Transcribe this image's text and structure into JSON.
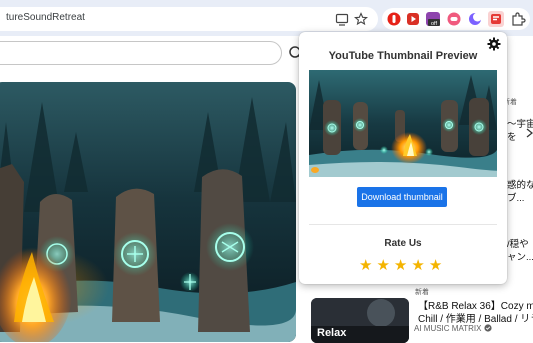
{
  "browser": {
    "url": "tureSoundRetreat"
  },
  "youtube": {
    "side_snippets": [
      "～宇宙",
      "を",
      "惑的な",
      "ブ...",
      "/穏や",
      "ャン..."
    ],
    "badge": "新着",
    "side_video": {
      "thumb_caption": "Relax",
      "title_line1": "【R&B Relax 36】Cozy music /",
      "title_line2": "Chill / 作業用 / Ballad / リラッ...",
      "channel": "AI MUSIC MATRIX"
    }
  },
  "popup": {
    "title": "YouTube Thumbnail Preview",
    "download_label": "Download thumbnail",
    "rate_label": "Rate Us",
    "stars": [
      "★",
      "★",
      "★",
      "★",
      "★"
    ],
    "rating": 5
  },
  "colors": {
    "accent": "#1a73e8",
    "star": "#f4b400",
    "toolbar": "#e8edf7"
  }
}
